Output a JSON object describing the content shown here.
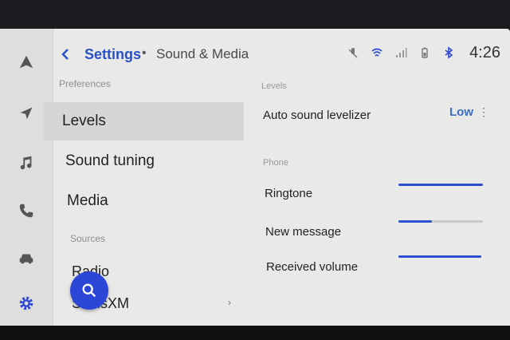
{
  "header": {
    "breadcrumb_root": "Settings",
    "separator": "•",
    "breadcrumb_current": "Sound & Media",
    "clock": "4:26"
  },
  "status_icons": [
    "mic-muted-icon",
    "wifi-icon",
    "signal-icon",
    "battery-icon",
    "bluetooth-icon"
  ],
  "rail": [
    "navigation-triangle-icon",
    "location-arrow-icon",
    "music-note-icon",
    "phone-icon",
    "car-icon",
    "gear-icon"
  ],
  "left": {
    "preferences_label": "Preferences",
    "items": [
      "Levels",
      "Sound tuning",
      "Media"
    ],
    "sources_label": "Sources",
    "sources": [
      "Radio",
      "SiriusXM"
    ]
  },
  "right": {
    "levels_section": "Levels",
    "auto_label": "Auto sound levelizer",
    "auto_value": "Low",
    "phone_section": "Phone",
    "sliders": [
      {
        "label": "Ringtone",
        "level": 1.0
      },
      {
        "label": "New message",
        "level": 0.4
      },
      {
        "label": "Received volume",
        "level": 1.0
      }
    ]
  },
  "colors": {
    "accent": "#2c46d8",
    "link": "#2850c8"
  }
}
